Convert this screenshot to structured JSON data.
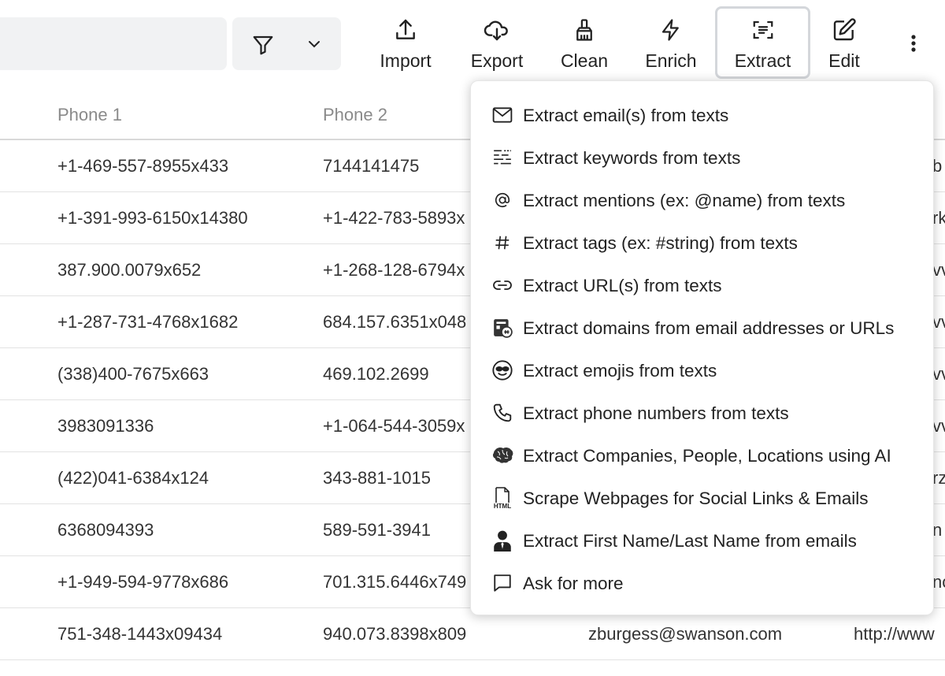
{
  "toolbar": {
    "import_label": "Import",
    "export_label": "Export",
    "clean_label": "Clean",
    "enrich_label": "Enrich",
    "extract_label": "Extract",
    "edit_label": "Edit"
  },
  "table": {
    "headers": [
      "Phone 1",
      "Phone 2"
    ],
    "rows": [
      {
        "phone1": "+1-469-557-8955x433",
        "phone2": "7144141475",
        "col3": "",
        "col4": "b"
      },
      {
        "phone1": "+1-391-993-6150x14380",
        "phone2": "+1-422-783-5893x",
        "col3": "",
        "col4": "rk"
      },
      {
        "phone1": "387.900.0079x652",
        "phone2": "+1-268-128-6794x",
        "col3": "",
        "col4": "vv"
      },
      {
        "phone1": "+1-287-731-4768x1682",
        "phone2": "684.157.6351x048",
        "col3": "",
        "col4": "vv"
      },
      {
        "phone1": "(338)400-7675x663",
        "phone2": "469.102.2699",
        "col3": "",
        "col4": "vv"
      },
      {
        "phone1": "3983091336",
        "phone2": "+1-064-544-3059x",
        "col3": "",
        "col4": "vv"
      },
      {
        "phone1": "(422)041-6384x124",
        "phone2": "343-881-1015",
        "col3": "",
        "col4": "rz"
      },
      {
        "phone1": "6368094393",
        "phone2": "589-591-3941",
        "col3": "",
        "col4": "n"
      },
      {
        "phone1": "+1-949-594-9778x686",
        "phone2": "701.315.6446x749",
        "col3": "",
        "col4": "nc"
      },
      {
        "phone1": "751-348-1443x09434",
        "phone2": "940.073.8398x809",
        "col3": "zburgess@swanson.com",
        "col4": "http://www"
      }
    ]
  },
  "extract_menu": {
    "items": [
      {
        "label": "Extract email(s) from texts",
        "icon": "envelope-icon"
      },
      {
        "label": "Extract keywords from texts",
        "icon": "keywords-icon"
      },
      {
        "label": "Extract mentions (ex: @name) from texts",
        "icon": "at-icon"
      },
      {
        "label": "Extract tags (ex: #string) from texts",
        "icon": "hashtag-icon"
      },
      {
        "label": "Extract URL(s) from texts",
        "icon": "link-icon"
      },
      {
        "label": "Extract domains from email addresses or URLs",
        "icon": "domain-icon"
      },
      {
        "label": "Extract emojis from texts",
        "icon": "emoji-icon"
      },
      {
        "label": "Extract phone numbers from texts",
        "icon": "phone-icon"
      },
      {
        "label": "Extract Companies, People, Locations using AI",
        "icon": "brain-icon"
      },
      {
        "label": "Scrape Webpages for Social Links & Emails",
        "icon": "html-file-icon"
      },
      {
        "label": "Extract First Name/Last Name from emails",
        "icon": "person-icon"
      },
      {
        "label": "Ask for more",
        "icon": "chat-bubble-icon"
      }
    ],
    "html_icon_text": "HTML"
  }
}
